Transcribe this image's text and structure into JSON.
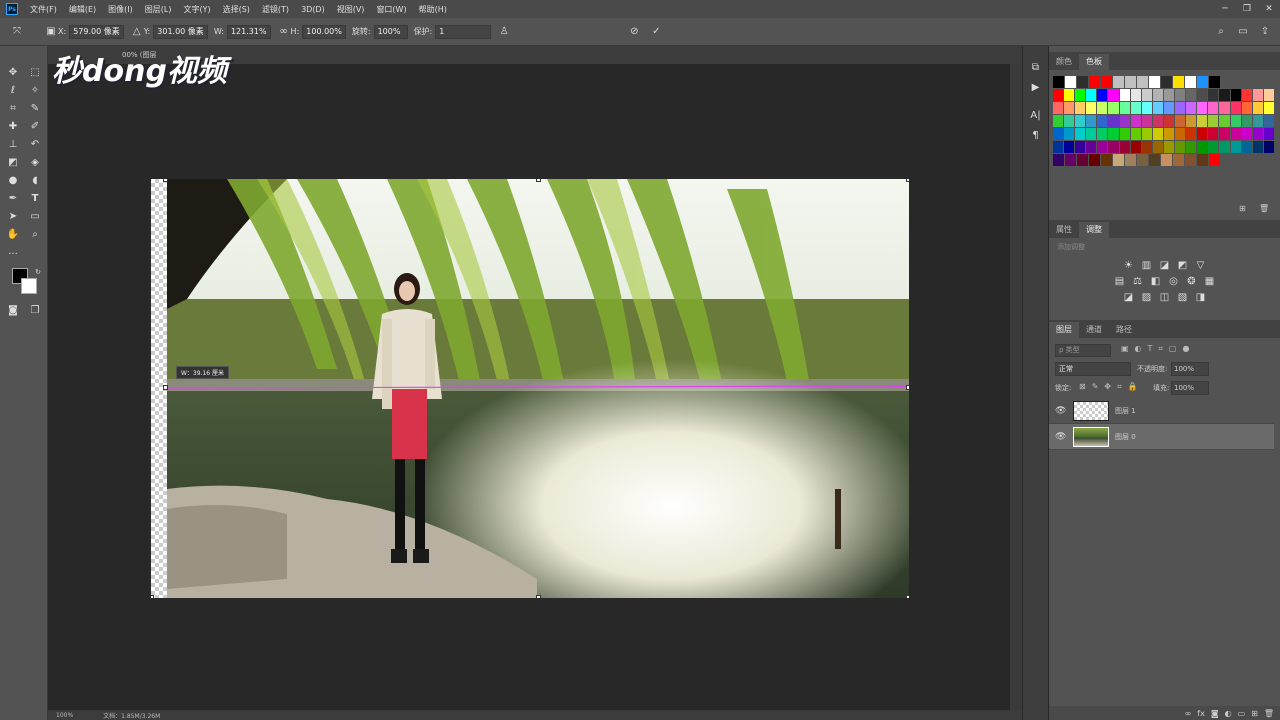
{
  "app": {
    "logo": "Ps"
  },
  "menu": [
    "文件(F)",
    "编辑(E)",
    "图像(I)",
    "图层(L)",
    "文字(Y)",
    "选择(S)",
    "滤镜(T)",
    "3D(D)",
    "视图(V)",
    "窗口(W)",
    "帮助(H)"
  ],
  "window_controls": {
    "minimize": "─",
    "restore": "❐",
    "close": "✕"
  },
  "options": {
    "x_label": "X:",
    "x_value": "579.00 像素",
    "y_label": "Y:",
    "y_value": "301.00 像素",
    "w_label": "W:",
    "w_value": "121.31%",
    "h_label": "H:",
    "h_value": "100.00%",
    "angle_label": "旋转:",
    "angle_value": "100%",
    "interp_label": "保护:",
    "interp_value": "1",
    "cancel_icon": "⊘",
    "commit_icon": "✓"
  },
  "tab": {
    "title": "00% (图层"
  },
  "watermark": "秒dong视频",
  "transform_tip": "W：39.16 厘米",
  "status": {
    "zoom": "100%",
    "doc": "文档：1.85M/3.26M"
  },
  "panels": {
    "top_tabs": [
      "颜色",
      "色板"
    ],
    "mid_tabs": [
      "属性",
      "调整"
    ],
    "mid_hint": "添加调整",
    "layer_tabs": [
      "图层",
      "通道",
      "路径"
    ],
    "filter_label": "ρ 类型",
    "blend_mode": "正常",
    "opacity_label": "不透明度:",
    "opacity_value": "100%",
    "lock_label": "锁定:",
    "fill_label": "填充:",
    "fill_value": "100%",
    "layers": [
      {
        "name": "图层 1"
      },
      {
        "name": "图层 0"
      }
    ]
  },
  "swatches": [
    [
      "#000000",
      "#ffffff",
      "#2d2d2d",
      "#ff0000",
      "#ff0000",
      "#c0c0c0",
      "#c0c0c0",
      "#c0c0c0",
      "#ffffff",
      "#2d2d2d",
      "#ffdf00",
      "#ffffff",
      "#1e90ff",
      "#000000"
    ],
    [
      "#ff0000",
      "#ffff00",
      "#00ff00",
      "#00ffff",
      "#0000ff",
      "#ff00ff",
      "#ffffff",
      "#e6e6e6",
      "#cccccc",
      "#b3b3b3",
      "#999999",
      "#808080",
      "#666666",
      "#4d4d4d",
      "#333333",
      "#1a1a1a",
      "#000000",
      "#ff3333",
      "#ff9999",
      "#ffcc99"
    ],
    [
      "#ff6666",
      "#ff9966",
      "#ffcc66",
      "#ffff66",
      "#ccff66",
      "#99ff66",
      "#66ff99",
      "#66ffcc",
      "#66ffff",
      "#66ccff",
      "#6699ff",
      "#9966ff",
      "#cc66ff",
      "#ff66ff",
      "#ff66cc",
      "#ff6699",
      "#ff3366",
      "#ff6633",
      "#ffcc33",
      "#ffff33"
    ],
    [
      "#33cc33",
      "#33cc99",
      "#33cccc",
      "#3399cc",
      "#3366cc",
      "#6633cc",
      "#9933cc",
      "#cc33cc",
      "#cc3399",
      "#cc3366",
      "#cc3333",
      "#cc6633",
      "#cc9933",
      "#cccc33",
      "#99cc33",
      "#66cc33",
      "#33cc66",
      "#339966",
      "#339999",
      "#336699"
    ],
    [
      "#0066cc",
      "#0099cc",
      "#00cccc",
      "#00cc99",
      "#00cc66",
      "#00cc33",
      "#33cc00",
      "#66cc00",
      "#99cc00",
      "#cccc00",
      "#cc9900",
      "#cc6600",
      "#cc3300",
      "#cc0000",
      "#cc0033",
      "#cc0066",
      "#cc0099",
      "#cc00cc",
      "#9900cc",
      "#6600cc"
    ],
    [
      "#003399",
      "#000099",
      "#330099",
      "#660099",
      "#990099",
      "#990066",
      "#990033",
      "#990000",
      "#993300",
      "#996600",
      "#999900",
      "#669900",
      "#339900",
      "#009900",
      "#009933",
      "#009966",
      "#009999",
      "#006699",
      "#003366",
      "#000066"
    ],
    [
      "#330066",
      "#660066",
      "#660033",
      "#660000",
      "#663300",
      "#c8a878",
      "#a08060",
      "#786040",
      "#504020",
      "#c89060",
      "#a06838",
      "#805030",
      "#603818",
      "#ff0000"
    ]
  ],
  "colors": {
    "accent": "#31a8ff",
    "guide": "#d946ef"
  }
}
